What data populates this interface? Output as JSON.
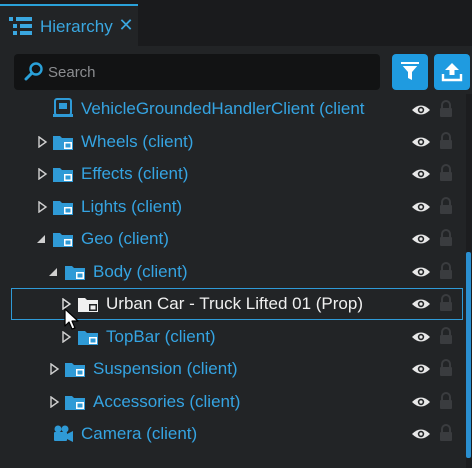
{
  "tab": {
    "title": "Hierarchy",
    "close": "✕"
  },
  "search": {
    "placeholder": "Search",
    "value": ""
  },
  "colors": {
    "accent": "#1f9be0",
    "label": "#35a4e2",
    "selected_border": "#2f9ad6"
  },
  "rows": [
    {
      "label": "VehicleGroundedHandlerClient (client",
      "expander": "none",
      "icon": "script-icon",
      "depth": 0
    },
    {
      "label": "Wheels (client)",
      "expander": "collapsed",
      "icon": "folder-icon",
      "depth": 0
    },
    {
      "label": "Effects (client)",
      "expander": "collapsed",
      "icon": "folder-icon",
      "depth": 0
    },
    {
      "label": "Lights (client)",
      "expander": "collapsed",
      "icon": "folder-icon",
      "depth": 0
    },
    {
      "label": "Geo (client)",
      "expander": "expanded",
      "icon": "folder-icon",
      "depth": 0
    },
    {
      "label": "Body (client)",
      "expander": "expanded",
      "icon": "folder-icon",
      "depth": 1
    },
    {
      "label": "Urban Car - Truck Lifted 01 (Prop)",
      "expander": "collapsed",
      "icon": "prop-folder-icon",
      "depth": 2,
      "selected": true
    },
    {
      "label": "TopBar (client)",
      "expander": "collapsed",
      "icon": "folder-icon",
      "depth": 2
    },
    {
      "label": "Suspension (client)",
      "expander": "collapsed",
      "icon": "folder-icon",
      "depth": 1
    },
    {
      "label": "Accessories (client)",
      "expander": "collapsed",
      "icon": "folder-icon",
      "depth": 1
    },
    {
      "label": "Camera (client)",
      "expander": "none",
      "icon": "camera-icon",
      "depth": 0
    }
  ]
}
